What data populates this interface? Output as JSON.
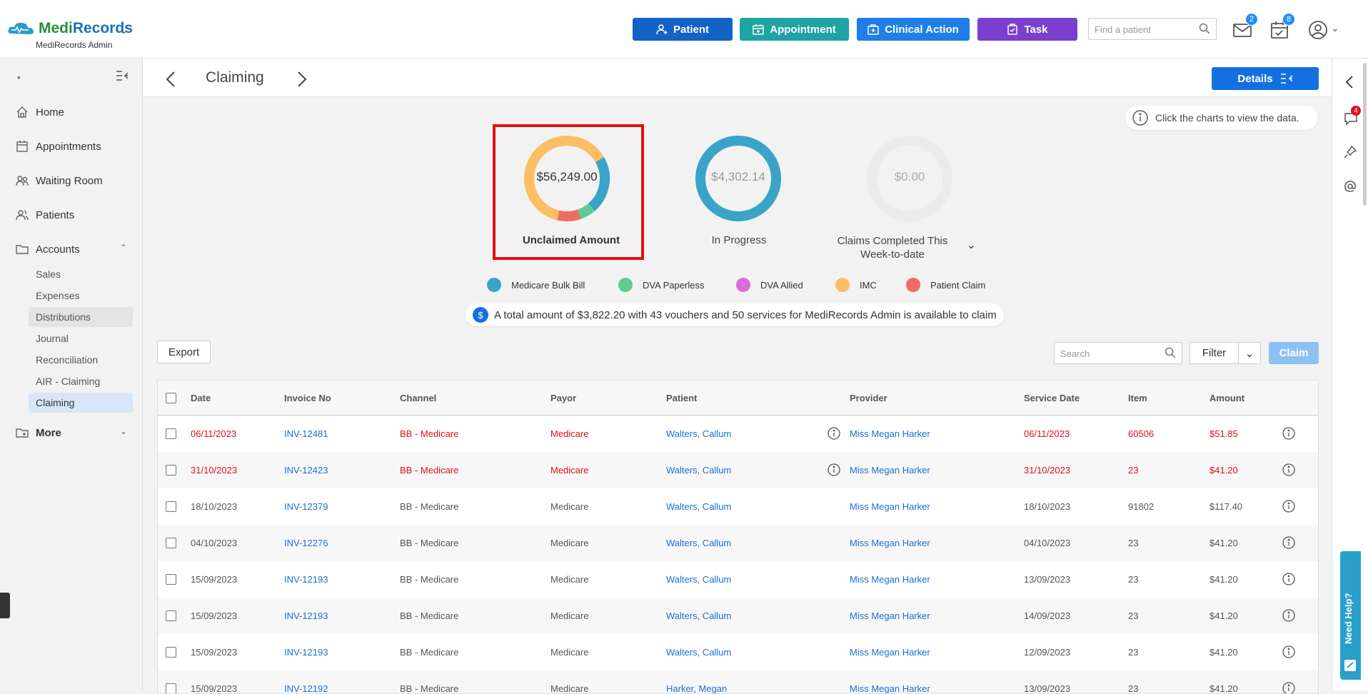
{
  "app": {
    "name_part1": "Medi",
    "name_part2": "Records",
    "account": "MediRecords Admin"
  },
  "topbar": {
    "buttons": [
      {
        "label": "Patient",
        "color": "#1362c6"
      },
      {
        "label": "Appointment",
        "color": "#1fa3a3"
      },
      {
        "label": "Clinical Action",
        "color": "#1e7fe8"
      },
      {
        "label": "Task",
        "color": "#7b3fd0"
      }
    ],
    "find_placeholder": "Find a patient",
    "mail_count": "2",
    "tasks_count": "8"
  },
  "sidebar": {
    "items": [
      {
        "label": "Home",
        "icon": "home-icon"
      },
      {
        "label": "Appointments",
        "icon": "calendar-icon"
      },
      {
        "label": "Waiting Room",
        "icon": "people-icon"
      },
      {
        "label": "Patients",
        "icon": "patients-icon"
      },
      {
        "label": "Accounts",
        "icon": "folder-icon"
      },
      {
        "label": "More",
        "icon": "more-folder-icon"
      }
    ],
    "accounts_sub": [
      "Sales",
      "Expenses",
      "Distributions",
      "Journal",
      "Reconciliation",
      "AIR - Claiming",
      "Claiming"
    ]
  },
  "page": {
    "title": "Claiming",
    "details_label": "Details",
    "hint": "Click the charts to view the data.",
    "charts": [
      {
        "value": "$56,249.00",
        "label": "Unclaimed Amount"
      },
      {
        "value": "$4,302.14",
        "label": "In Progress"
      },
      {
        "value": "$0.00",
        "label": "Claims Completed This Week-to-date"
      }
    ],
    "legend": [
      {
        "label": "Medicare Bulk Bill",
        "color": "#3aa3c8"
      },
      {
        "label": "DVA Paperless",
        "color": "#5ecb8f"
      },
      {
        "label": "DVA Allied",
        "color": "#d86ddb"
      },
      {
        "label": "IMC",
        "color": "#fbbe64"
      },
      {
        "label": "Patient Claim",
        "color": "#ef6c62"
      }
    ],
    "summary": "A total amount of $3,822.20 with 43 vouchers and 50 services for MediRecords Admin is available to claim",
    "export_label": "Export",
    "search_placeholder": "Search",
    "filter_label": "Filter",
    "claim_label": "Claim"
  },
  "chart_data": {
    "type": "pie",
    "title": "Unclaimed Amount",
    "total": "$56,249.00",
    "categories": [
      "Medicare Bulk Bill",
      "DVA Paperless",
      "IMC",
      "Patient Claim"
    ],
    "values": [
      0.22,
      0.06,
      0.63,
      0.09
    ]
  },
  "table": {
    "columns": [
      "Date",
      "Invoice No",
      "Channel",
      "Payor",
      "Patient",
      "Provider",
      "Service Date",
      "Item",
      "Amount"
    ],
    "rows": [
      {
        "date": "06/11/2023",
        "invoice": "INV-12481",
        "channel": "BB - Medicare",
        "payor": "Medicare",
        "patient": "Walters, Callum",
        "provider": "Miss Megan Harker",
        "service_date": "06/11/2023",
        "item": "60506",
        "amount": "$51.85",
        "flag": true
      },
      {
        "date": "31/10/2023",
        "invoice": "INV-12423",
        "channel": "BB - Medicare",
        "payor": "Medicare",
        "patient": "Walters, Callum",
        "provider": "Miss Megan Harker",
        "service_date": "31/10/2023",
        "item": "23",
        "amount": "$41.20",
        "flag": true
      },
      {
        "date": "18/10/2023",
        "invoice": "INV-12379",
        "channel": "BB - Medicare",
        "payor": "Medicare",
        "patient": "Walters, Callum",
        "provider": "Miss Megan Harker",
        "service_date": "18/10/2023",
        "item": "91802",
        "amount": "$117.40",
        "flag": false
      },
      {
        "date": "04/10/2023",
        "invoice": "INV-12276",
        "channel": "BB - Medicare",
        "payor": "Medicare",
        "patient": "Walters, Callum",
        "provider": "Miss Megan Harker",
        "service_date": "04/10/2023",
        "item": "23",
        "amount": "$41.20",
        "flag": false
      },
      {
        "date": "15/09/2023",
        "invoice": "INV-12193",
        "channel": "BB - Medicare",
        "payor": "Medicare",
        "patient": "Walters, Callum",
        "provider": "Miss Megan Harker",
        "service_date": "13/09/2023",
        "item": "23",
        "amount": "$41.20",
        "flag": false
      },
      {
        "date": "15/09/2023",
        "invoice": "INV-12193",
        "channel": "BB - Medicare",
        "payor": "Medicare",
        "patient": "Walters, Callum",
        "provider": "Miss Megan Harker",
        "service_date": "14/09/2023",
        "item": "23",
        "amount": "$41.20",
        "flag": false
      },
      {
        "date": "15/09/2023",
        "invoice": "INV-12193",
        "channel": "BB - Medicare",
        "payor": "Medicare",
        "patient": "Walters, Callum",
        "provider": "Miss Megan Harker",
        "service_date": "12/09/2023",
        "item": "23",
        "amount": "$41.20",
        "flag": false
      },
      {
        "date": "15/09/2023",
        "invoice": "INV-12192",
        "channel": "BB - Medicare",
        "payor": "Medicare",
        "patient": "Harker, Megan",
        "provider": "Miss Megan Harker",
        "service_date": "13/09/2023",
        "item": "23",
        "amount": "$41.20",
        "flag": false
      }
    ]
  },
  "rightbar": {
    "notifications": "4"
  },
  "help_label": "Need Help?"
}
